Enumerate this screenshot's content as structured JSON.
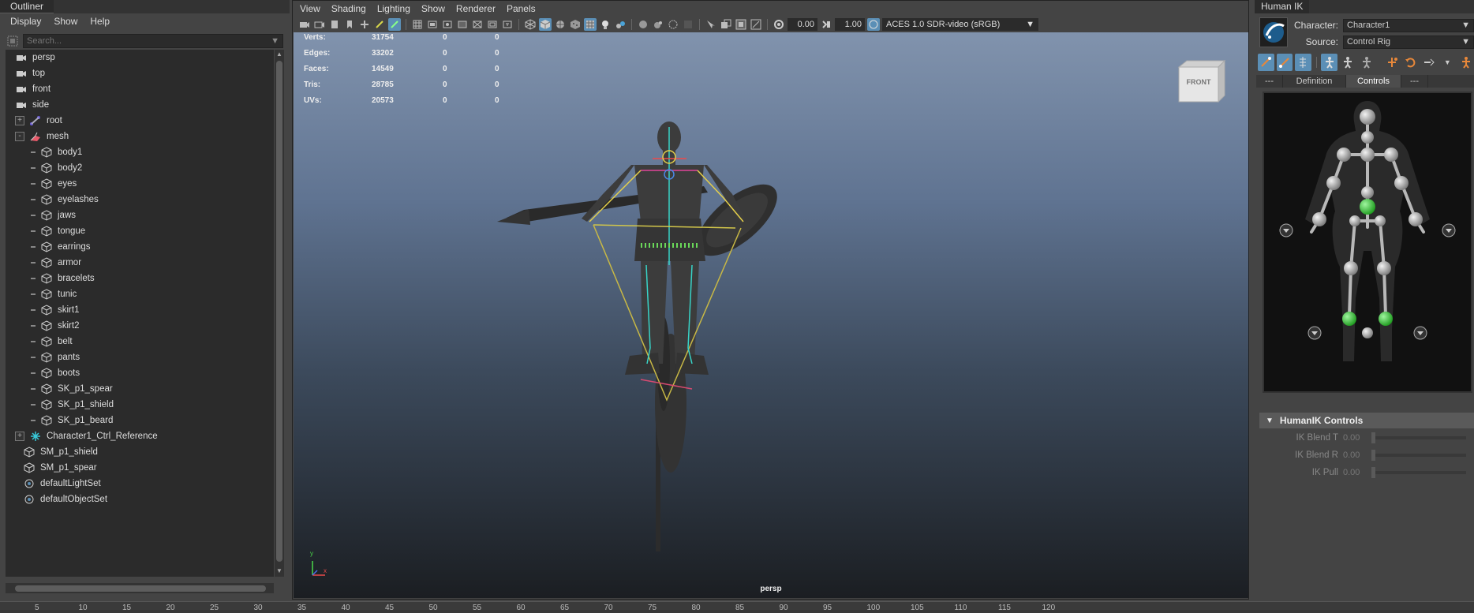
{
  "outliner": {
    "tab_title": "Outliner",
    "menu": [
      "Display",
      "Show",
      "Help"
    ],
    "search_placeholder": "Search...",
    "items": [
      {
        "label": "persp",
        "icon": "camera-icon",
        "indent": 1,
        "expander": ""
      },
      {
        "label": "top",
        "icon": "camera-icon",
        "indent": 1,
        "expander": ""
      },
      {
        "label": "front",
        "icon": "camera-icon",
        "indent": 1,
        "expander": ""
      },
      {
        "label": "side",
        "icon": "camera-icon",
        "indent": 1,
        "expander": ""
      },
      {
        "label": "root",
        "icon": "joint-icon",
        "indent": 0,
        "expander": "+"
      },
      {
        "label": "mesh",
        "icon": "mesh-group-icon",
        "indent": 0,
        "expander": "-"
      },
      {
        "label": "body1",
        "icon": "poly-mesh-icon",
        "indent": 2,
        "expander": ""
      },
      {
        "label": "body2",
        "icon": "poly-mesh-icon",
        "indent": 2,
        "expander": ""
      },
      {
        "label": "eyes",
        "icon": "poly-mesh-icon",
        "indent": 2,
        "expander": ""
      },
      {
        "label": "eyelashes",
        "icon": "poly-mesh-icon",
        "indent": 2,
        "expander": ""
      },
      {
        "label": "jaws",
        "icon": "poly-mesh-icon",
        "indent": 2,
        "expander": ""
      },
      {
        "label": "tongue",
        "icon": "poly-mesh-icon",
        "indent": 2,
        "expander": ""
      },
      {
        "label": "earrings",
        "icon": "poly-mesh-icon",
        "indent": 2,
        "expander": ""
      },
      {
        "label": "armor",
        "icon": "poly-mesh-icon",
        "indent": 2,
        "expander": ""
      },
      {
        "label": "bracelets",
        "icon": "poly-mesh-icon",
        "indent": 2,
        "expander": ""
      },
      {
        "label": "tunic",
        "icon": "poly-mesh-icon",
        "indent": 2,
        "expander": ""
      },
      {
        "label": "skirt1",
        "icon": "poly-mesh-icon",
        "indent": 2,
        "expander": ""
      },
      {
        "label": "skirt2",
        "icon": "poly-mesh-icon",
        "indent": 2,
        "expander": ""
      },
      {
        "label": "belt",
        "icon": "poly-mesh-icon",
        "indent": 2,
        "expander": ""
      },
      {
        "label": "pants",
        "icon": "poly-mesh-icon",
        "indent": 2,
        "expander": ""
      },
      {
        "label": "boots",
        "icon": "poly-mesh-icon",
        "indent": 2,
        "expander": ""
      },
      {
        "label": "SK_p1_spear",
        "icon": "poly-mesh-icon",
        "indent": 2,
        "expander": ""
      },
      {
        "label": "SK_p1_shield",
        "icon": "poly-mesh-icon",
        "indent": 2,
        "expander": ""
      },
      {
        "label": "SK_p1_beard",
        "icon": "poly-mesh-icon",
        "indent": 2,
        "expander": ""
      },
      {
        "label": "Character1_Ctrl_Reference",
        "icon": "hik-reference-icon",
        "indent": 0,
        "expander": "+"
      },
      {
        "label": "SM_p1_shield",
        "icon": "poly-mesh-icon",
        "indent": 3,
        "expander": ""
      },
      {
        "label": "SM_p1_spear",
        "icon": "poly-mesh-icon",
        "indent": 3,
        "expander": ""
      },
      {
        "label": "defaultLightSet",
        "icon": "set-icon",
        "indent": 3,
        "expander": ""
      },
      {
        "label": "defaultObjectSet",
        "icon": "set-icon",
        "indent": 3,
        "expander": ""
      }
    ]
  },
  "viewport": {
    "menu": [
      "View",
      "Shading",
      "Lighting",
      "Show",
      "Renderer",
      "Panels"
    ],
    "exposure": "0.00",
    "gamma": "1.00",
    "color_space": "ACES 1.0 SDR-video (sRGB)",
    "hud": [
      {
        "label": "Verts:",
        "value": "31754",
        "a": "0",
        "b": "0"
      },
      {
        "label": "Edges:",
        "value": "33202",
        "a": "0",
        "b": "0"
      },
      {
        "label": "Faces:",
        "value": "14549",
        "a": "0",
        "b": "0"
      },
      {
        "label": "Tris:",
        "value": "28785",
        "a": "0",
        "b": "0"
      },
      {
        "label": "UVs:",
        "value": "20573",
        "a": "0",
        "b": "0"
      }
    ],
    "viewcube_label": "FRONT",
    "camera_label": "persp",
    "axis_labels": {
      "y": "y",
      "x": "x"
    }
  },
  "timeline": {
    "ticks": [
      "5",
      "10",
      "15",
      "20",
      "25",
      "30",
      "35",
      "40",
      "45",
      "50",
      "55",
      "60",
      "65",
      "70",
      "75",
      "80",
      "85",
      "90",
      "95",
      "100",
      "105",
      "110",
      "115",
      "120"
    ]
  },
  "humanik": {
    "tab_title": "Human IK",
    "character_label": "Character:",
    "character_value": "Character1",
    "source_label": "Source:",
    "source_value": "Control Rig",
    "tabs": [
      "---",
      "Definition",
      "Controls",
      "---"
    ],
    "active_tab": "Controls",
    "section_title": "HumanIK Controls",
    "props": [
      {
        "label": "IK Blend T",
        "value": "0.00"
      },
      {
        "label": "IK Blend R",
        "value": "0.00"
      },
      {
        "label": "IK Pull",
        "value": "0.00"
      }
    ]
  },
  "colors": {
    "accent": "#5b8fb6",
    "effector_green": "#3fd23f",
    "joint_grey": "#c8c8c8"
  }
}
